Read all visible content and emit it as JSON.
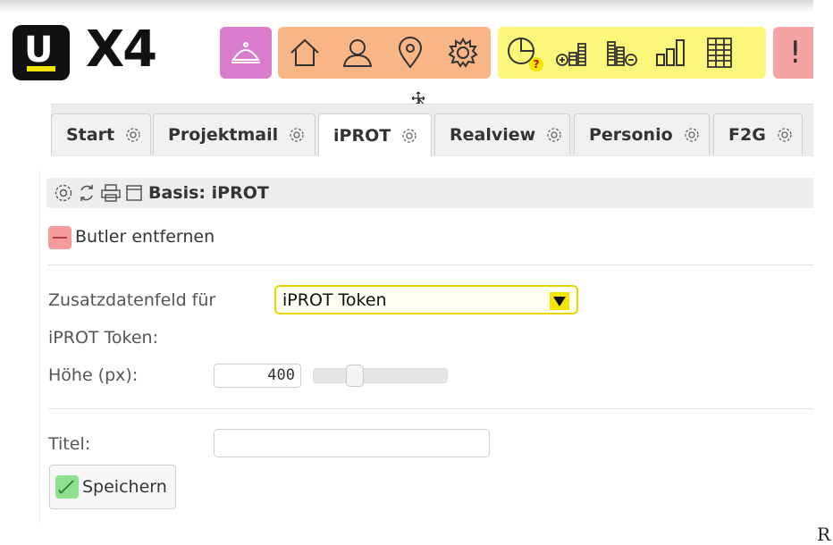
{
  "brand": {
    "logo_letter": "U",
    "product": "X4"
  },
  "toolbar": {
    "colors": {
      "pink": "#d97ccb",
      "orange": "#f8b585",
      "yellow": "#fbf77b",
      "red": "#f6a3a3"
    },
    "groups": [
      {
        "name": "pink",
        "icons": [
          "butler-bell-icon"
        ]
      },
      {
        "name": "orange",
        "icons": [
          "home-icon",
          "user-icon",
          "location-pin-icon",
          "settings-gear-icon"
        ]
      },
      {
        "name": "yellow",
        "icons": [
          "clock-warning-icon",
          "coins-add-icon",
          "coins-remove-icon",
          "bar-chart-icon",
          "spreadsheet-icon"
        ]
      },
      {
        "name": "red",
        "icons": [
          "alert-icon"
        ]
      }
    ],
    "clock_badge": "?",
    "alert_label": "!"
  },
  "tabs": [
    {
      "label": "Start",
      "active": false
    },
    {
      "label": "Projektmail",
      "active": false
    },
    {
      "label": "iPROT",
      "active": true
    },
    {
      "label": "Realview",
      "active": false
    },
    {
      "label": "Personio",
      "active": false
    },
    {
      "label": "F2G",
      "active": false
    }
  ],
  "panel": {
    "title": "Basis: iPROT",
    "remove_butler_label": "Butler entfernen",
    "field_label_line1": "Zusatzdatenfeld für",
    "field_label_line2": "iPROT Token:",
    "field_select_value": "iPROT Token",
    "height_label": "Höhe (px):",
    "height_value": "400",
    "height_slider_fraction": 0.28,
    "title_label": "Titel:",
    "title_value": "",
    "save_label": "Speichern"
  },
  "corner_text": "R"
}
